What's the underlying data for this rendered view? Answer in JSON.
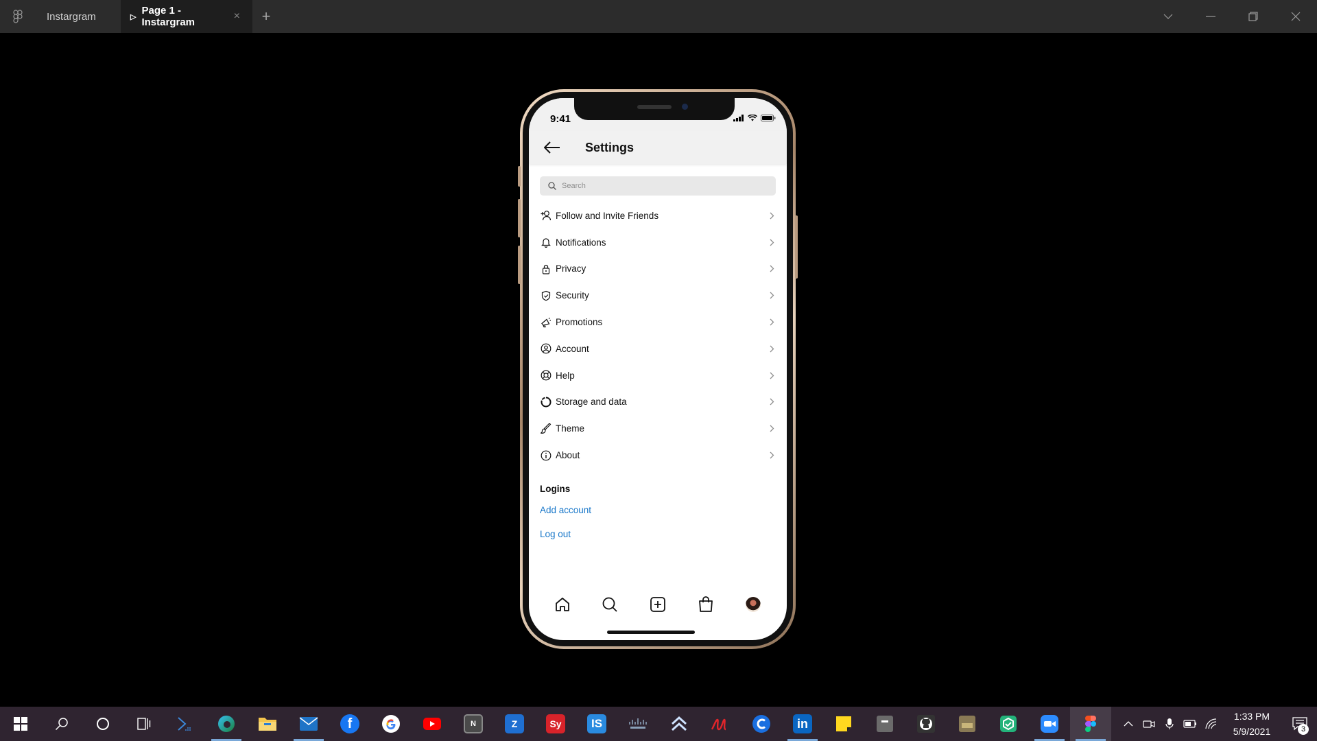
{
  "titlebar": {
    "home_tab": "Instargram",
    "active_tab": "Page 1 - Instargram",
    "play_glyph": "▷",
    "close_glyph": "×",
    "add_glyph": "+"
  },
  "phone": {
    "status_time": "9:41",
    "header_title": "Settings",
    "search_placeholder": "Search",
    "menu": [
      {
        "label": "Follow and Invite Friends",
        "icon": "add-person-icon"
      },
      {
        "label": "Notifications",
        "icon": "bell-icon"
      },
      {
        "label": "Privacy",
        "icon": "lock-icon"
      },
      {
        "label": "Security",
        "icon": "shield-icon"
      },
      {
        "label": "Promotions",
        "icon": "megaphone-icon"
      },
      {
        "label": "Account",
        "icon": "person-circle-icon"
      },
      {
        "label": "Help",
        "icon": "lifebuoy-icon"
      },
      {
        "label": "Storage and data",
        "icon": "circle-data-icon"
      },
      {
        "label": "Theme",
        "icon": "brush-icon"
      },
      {
        "label": "About",
        "icon": "info-icon"
      }
    ],
    "logins": {
      "heading": "Logins",
      "add_account": "Add account",
      "log_out": "Log out"
    },
    "link_color": "#1877c9"
  },
  "taskbar": {
    "time": "1:33 PM",
    "date": "5/9/2021",
    "notification_count": "3",
    "apps": [
      {
        "name": "notion",
        "text": "N",
        "color": "#4a4a4a"
      },
      {
        "name": "zoho",
        "text": "Z",
        "color": "#1f6fd1"
      },
      {
        "name": "symbolab",
        "text": "Sy",
        "color": "#d8232a"
      },
      {
        "name": "is-app",
        "text": "IS",
        "color": "#2a8be0"
      },
      {
        "name": "linkedin",
        "text": "in",
        "color": "#0a66c2"
      }
    ]
  }
}
